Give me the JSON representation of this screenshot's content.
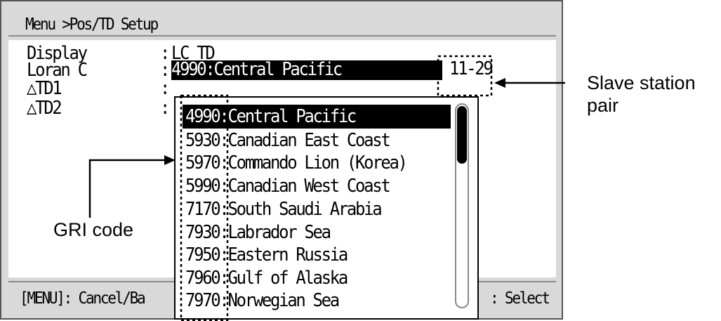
{
  "menu": {
    "title": "Menu >Pos/TD Setup"
  },
  "settings": {
    "display_label": "Display",
    "display_value": "LC TD",
    "loran_label": "Loran C",
    "loran_value": "4990:Central Pacific",
    "slave_pair": "11-29",
    "td1_label": "△TD1",
    "td2_label": "△TD2",
    "colon": ":"
  },
  "footer": {
    "left": "[MENU]: Cancel/Ba",
    "right": ": Select"
  },
  "dropdown": {
    "items": [
      {
        "code": "4990",
        "name": "Central Pacific",
        "selected": true
      },
      {
        "code": "5930",
        "name": "Canadian East Coast"
      },
      {
        "code": "5970",
        "name": "Commando Lion (Korea)"
      },
      {
        "code": "5990",
        "name": "Canadian West Coast"
      },
      {
        "code": "7170",
        "name": "South Saudi Arabia"
      },
      {
        "code": "7930",
        "name": "Labrador Sea"
      },
      {
        "code": "7950",
        "name": "Eastern Russia"
      },
      {
        "code": "7960",
        "name": "Gulf of Alaska"
      },
      {
        "code": "7970",
        "name": "Norwegian Sea"
      }
    ]
  },
  "annotations": {
    "slave_station_line1": "Slave station",
    "slave_station_line2": "pair",
    "gri_code": "GRI code"
  }
}
